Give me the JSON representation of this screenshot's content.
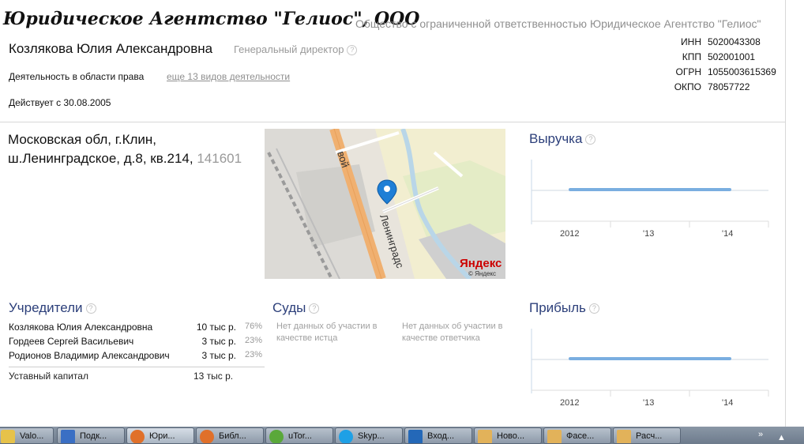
{
  "header": {
    "company_short": "Юридическое Агентство \"Гелиос\", ООО",
    "company_full": "Общество с ограниченной ответственностью Юридическое Агентство \"Гелиос\""
  },
  "director": {
    "name": "Козлякова Юлия Александровна",
    "role": "Генеральный директор"
  },
  "activity": {
    "main": "Деятельность в области права",
    "more_link": "еще 13 видов деятельности"
  },
  "since": "Действует с 30.08.2005",
  "codes": [
    {
      "key": "ИНН",
      "value": "5020043308"
    },
    {
      "key": "КПП",
      "value": "502001001"
    },
    {
      "key": "ОГРН",
      "value": "1055003615369"
    },
    {
      "key": "ОКПО",
      "value": "78057722"
    }
  ],
  "address": {
    "line1": "Московская обл, г.Клин,",
    "line2": "ш.Ленинградское, д.8, кв.214,",
    "zip": "141601"
  },
  "map": {
    "street_label_1": "Ленинградс",
    "street_label_2": "вой",
    "brand": "Яндекс",
    "copyright": "© Яндекс"
  },
  "revenue": {
    "title": "Выручка",
    "ticks": [
      "2012",
      "'13",
      "'14"
    ]
  },
  "profit": {
    "title": "Прибыль",
    "ticks": [
      "2012",
      "'13",
      "'14"
    ]
  },
  "founders": {
    "title": "Учредители",
    "rows": [
      {
        "name": "Козлякова Юлия Александровна",
        "amount": "10 тыс р.",
        "pct": "76%"
      },
      {
        "name": "Гордеев Сергей Васильевич",
        "amount": "3 тыс р.",
        "pct": "23%"
      },
      {
        "name": "Родионов Владимир Александрович",
        "amount": "3 тыс р.",
        "pct": "23%"
      }
    ],
    "capital_label": "Уставный капитал",
    "capital_value": "13 тыс р."
  },
  "courts": {
    "title": "Суды",
    "plaintiff": "Нет данных об участии в качестве истца",
    "defendant": "Нет данных об участии в качестве ответчика"
  },
  "taskbar": {
    "items": [
      {
        "label": "Valo...",
        "color": "#e6c24a"
      },
      {
        "label": "Подк...",
        "color": "#3a6fc4"
      },
      {
        "label": "Юри...",
        "color": "#e0702a"
      },
      {
        "label": "Библ...",
        "color": "#e0702a"
      },
      {
        "label": "uTor...",
        "color": "#5aa83a"
      },
      {
        "label": "Skyp...",
        "color": "#1ea0e6"
      },
      {
        "label": "Вход...",
        "color": "#2468b8"
      },
      {
        "label": "Ново...",
        "color": "#e2b25a"
      },
      {
        "label": "Фасе...",
        "color": "#e2b25a"
      },
      {
        "label": "Расч...",
        "color": "#e2b25a"
      }
    ],
    "tray_chevron": "»"
  }
}
